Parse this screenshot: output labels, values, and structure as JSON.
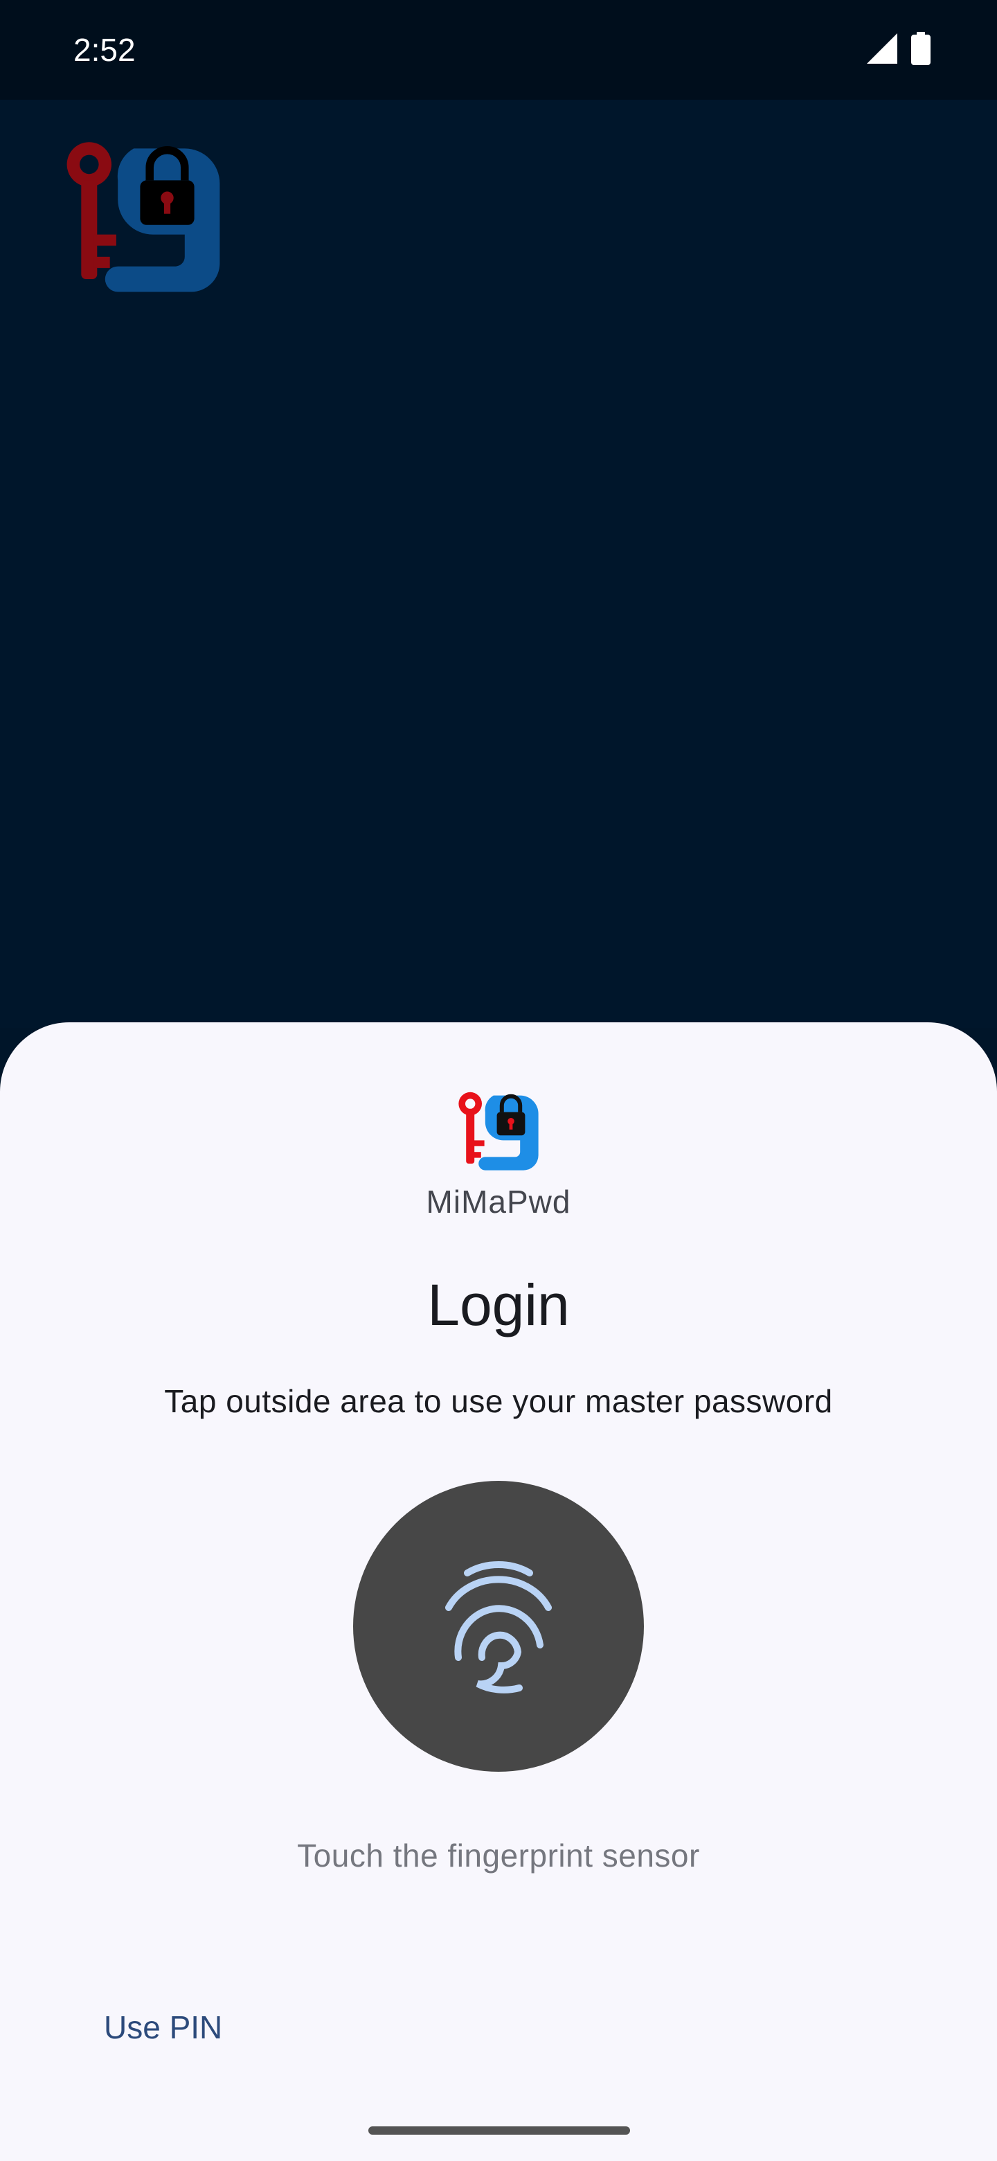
{
  "status_bar": {
    "time": "2:52",
    "icons": [
      "signal-icon",
      "battery-icon"
    ]
  },
  "app_background": {
    "logo_icon": "app-logo-icon"
  },
  "biometric_sheet": {
    "app_icon": "app-logo-icon",
    "app_name": "MiMaPwd",
    "title": "Login",
    "subtitle": "Tap outside area to use your master password",
    "fingerprint_icon": "fingerprint-icon",
    "hint": "Touch the fingerprint sensor",
    "use_pin_label": "Use PIN"
  },
  "colors": {
    "app_background": "#00162b",
    "sheet_background": "#f8f7fd",
    "fingerprint_circle": "#474747",
    "fingerprint_glyph": "#b9d3f5",
    "accent_text": "#2c4a7b",
    "logo_key_red": "#e8121b",
    "logo_lock_blue": "#1e8ee6"
  }
}
